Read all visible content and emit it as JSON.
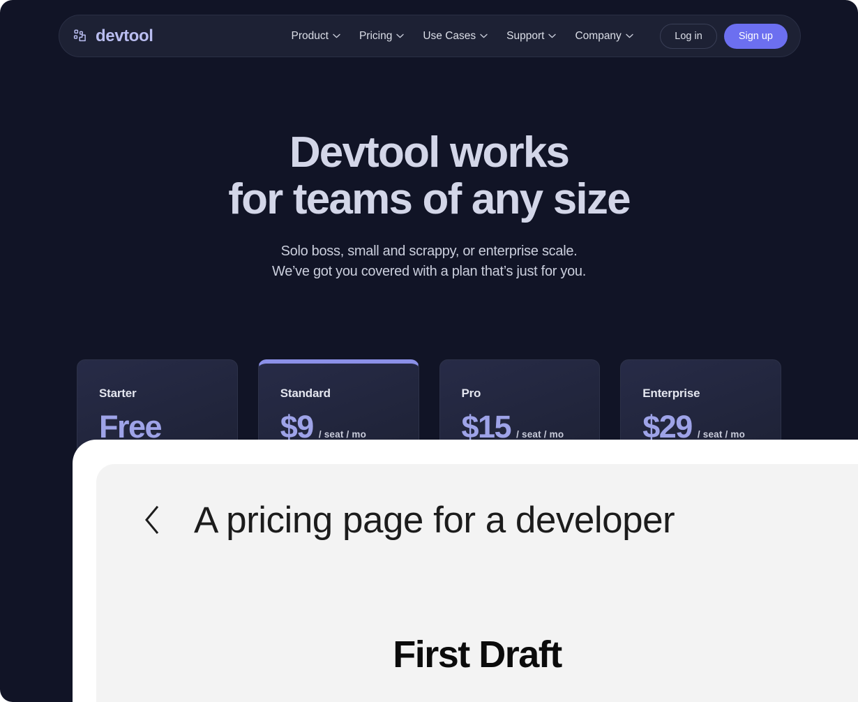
{
  "brand": {
    "name": "devtool",
    "logo_icon": "blocks-stairs-icon",
    "accent_color": "#6c6ff0",
    "brand_text_color": "#b9bdf0"
  },
  "nav": {
    "links": [
      {
        "label": "Product",
        "icon": "chevron-down-icon"
      },
      {
        "label": "Pricing",
        "icon": "chevron-down-icon"
      },
      {
        "label": "Use Cases",
        "icon": "chevron-down-icon"
      },
      {
        "label": "Support",
        "icon": "chevron-down-icon"
      },
      {
        "label": "Company",
        "icon": "chevron-down-icon"
      }
    ],
    "login_label": "Log in",
    "signup_label": "Sign up"
  },
  "hero": {
    "title_line1": "Devtool works",
    "title_line2": "for teams of any size",
    "sub_line1": "Solo boss, small and scrappy, or enterprise scale.",
    "sub_line2": "We’ve got you covered with a plan that’s just for you."
  },
  "pricing": {
    "unit": "/ seat / mo",
    "plans": [
      {
        "name": "Starter",
        "price": "Free",
        "unit": "",
        "featured": false
      },
      {
        "name": "Standard",
        "price": "$9",
        "unit": "/ seat / mo",
        "featured": true
      },
      {
        "name": "Pro",
        "price": "$15",
        "unit": "/ seat / mo",
        "featured": false
      },
      {
        "name": "Enterprise",
        "price": "$29",
        "unit": "/ seat / mo",
        "featured": false
      }
    ]
  },
  "overlay": {
    "back_icon": "chevron-left-icon",
    "title": "A pricing page for a developer",
    "draft_label": "First Draft"
  },
  "colors": {
    "page_bg": "#111426",
    "nav_bg": "#1d2134",
    "card_bg": "#232741",
    "price_accent": "#9ea3e8",
    "featured_border": "#8b90e8",
    "sheet_bg": "#ffffff",
    "doc_bg": "#f3f3f3"
  }
}
